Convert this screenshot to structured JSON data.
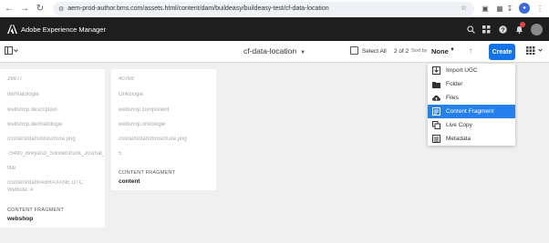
{
  "browser": {
    "url": "aem-prod-author.bms.com/assets.html/content/dam/buildeasy/buildeasy-test/cf-data-location",
    "profile_initial": "●"
  },
  "aem": {
    "title": "Adobe Experience Manager"
  },
  "action_bar": {
    "folder_title": "cf-data-location",
    "select_all_label": "Select All",
    "page_count": "2 of 2",
    "sort_label": "Sort by",
    "sort_value": "None",
    "create_label": "Create"
  },
  "cards": [
    {
      "meta": [
        "26677",
        "dermatologie",
        "webshop description",
        "webshop.dermatologie",
        "/content/dam/broschure.png",
        "75490_Breyanzi_Sonderdruck_Journal_Oncology_...",
        "title",
        "/content/dam/ABRAXANE DTC",
        "Website..4"
      ],
      "type_label": "CONTENT FRAGMENT",
      "title": "webshop"
    },
    {
      "meta": [
        "40768",
        "Onkologie",
        "webshop component",
        "webshop.onkologie",
        "/content/dam/broschure.png",
        "5"
      ],
      "type_label": "CONTENT FRAGMENT",
      "title": "content"
    }
  ],
  "create_menu": {
    "items": [
      {
        "label": "Import UGC",
        "icon": "import-icon",
        "selected": false
      },
      {
        "label": "Folder",
        "icon": "folder-icon",
        "selected": false
      },
      {
        "label": "Files",
        "icon": "upload-icon",
        "selected": false
      },
      {
        "label": "Content Fragment",
        "icon": "content-fragment-icon",
        "selected": true
      },
      {
        "label": "Live Copy",
        "icon": "live-copy-icon",
        "selected": false
      },
      {
        "label": "Metadata",
        "icon": "metadata-icon",
        "selected": false
      }
    ]
  },
  "colors": {
    "aem_header": "#1e1e1e",
    "create_button": "#1473e6",
    "menu_selected": "#2680eb",
    "notification": "#e34850"
  }
}
